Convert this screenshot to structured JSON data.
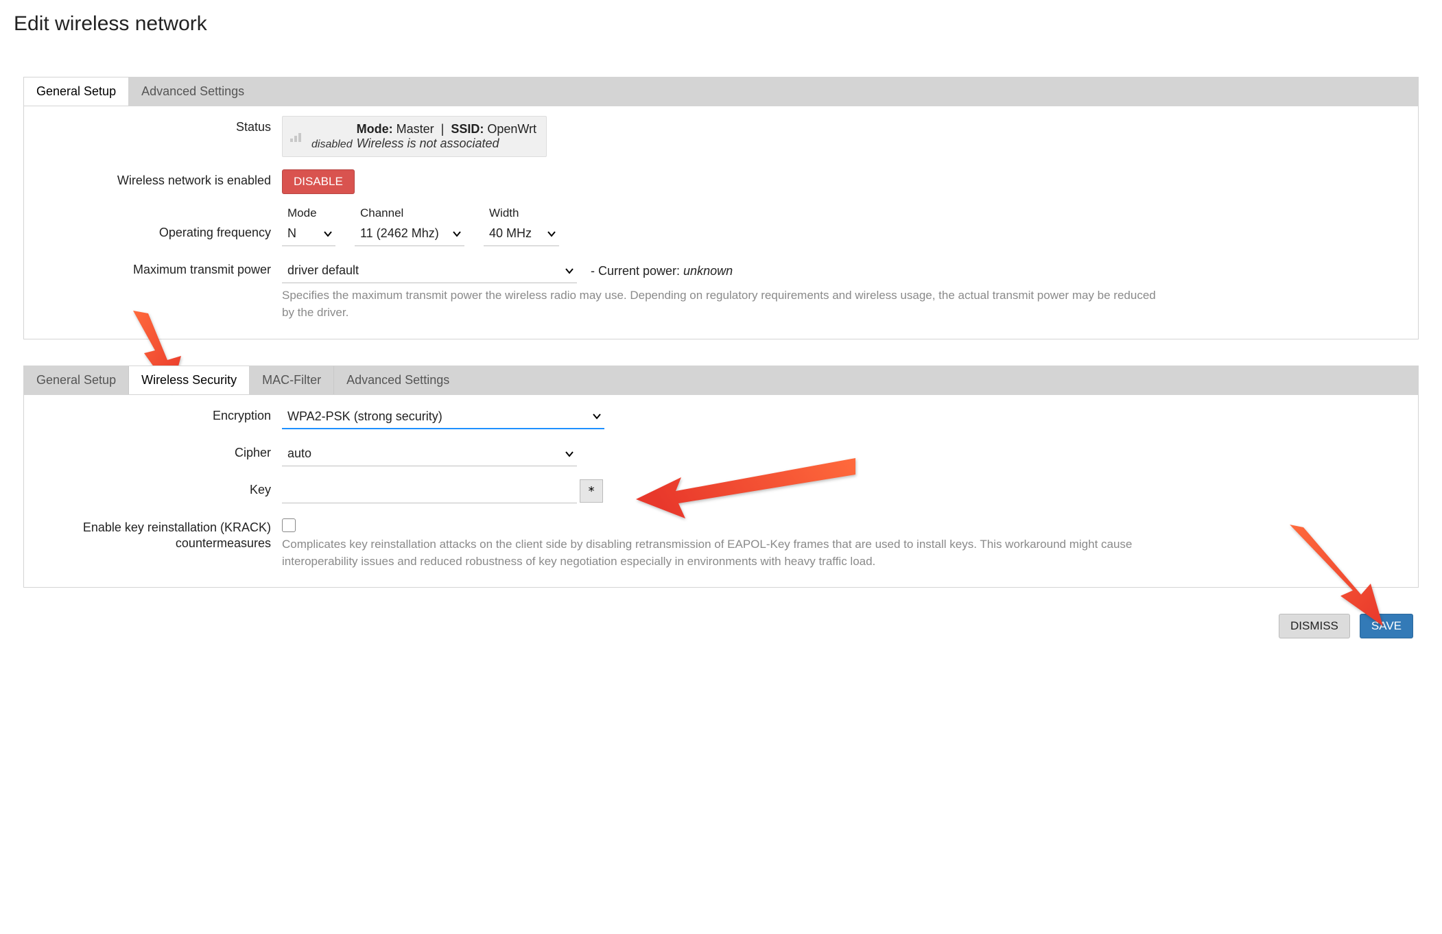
{
  "title": "Edit wireless network",
  "panel1": {
    "tabs": [
      "General Setup",
      "Advanced Settings"
    ],
    "active_tab": 0,
    "status": {
      "label": "Status",
      "disabled_word": "disabled",
      "mode_label": "Mode:",
      "mode_value": "Master",
      "ssid_label": "SSID:",
      "ssid_value": "OpenWrt",
      "assoc": "Wireless is not associated"
    },
    "enabled": {
      "label": "Wireless network is enabled",
      "button": "DISABLE"
    },
    "freq": {
      "label": "Operating frequency",
      "mode_col": "Mode",
      "mode_val": "N",
      "channel_col": "Channel",
      "channel_val": "11 (2462 Mhz)",
      "width_col": "Width",
      "width_val": "40 MHz"
    },
    "txpower": {
      "label": "Maximum transmit power",
      "value": "driver default",
      "after_prefix": "- Current power: ",
      "after_value": "unknown",
      "help": "Specifies the maximum transmit power the wireless radio may use. Depending on regulatory requirements and wireless usage, the actual transmit power may be reduced by the driver."
    }
  },
  "panel2": {
    "tabs": [
      "General Setup",
      "Wireless Security",
      "MAC-Filter",
      "Advanced Settings"
    ],
    "active_tab": 1,
    "encryption": {
      "label": "Encryption",
      "value": "WPA2-PSK (strong security)"
    },
    "cipher": {
      "label": "Cipher",
      "value": "auto"
    },
    "key": {
      "label": "Key",
      "value": "",
      "reveal": "*"
    },
    "krack": {
      "label_line1": "Enable key reinstallation (KRACK)",
      "label_line2": "countermeasures",
      "help": "Complicates key reinstallation attacks on the client side by disabling retransmission of EAPOL-Key frames that are used to install keys. This workaround might cause interoperability issues and reduced robustness of key negotiation especially in environments with heavy traffic load."
    }
  },
  "footer": {
    "dismiss": "DISMISS",
    "save": "SAVE"
  }
}
